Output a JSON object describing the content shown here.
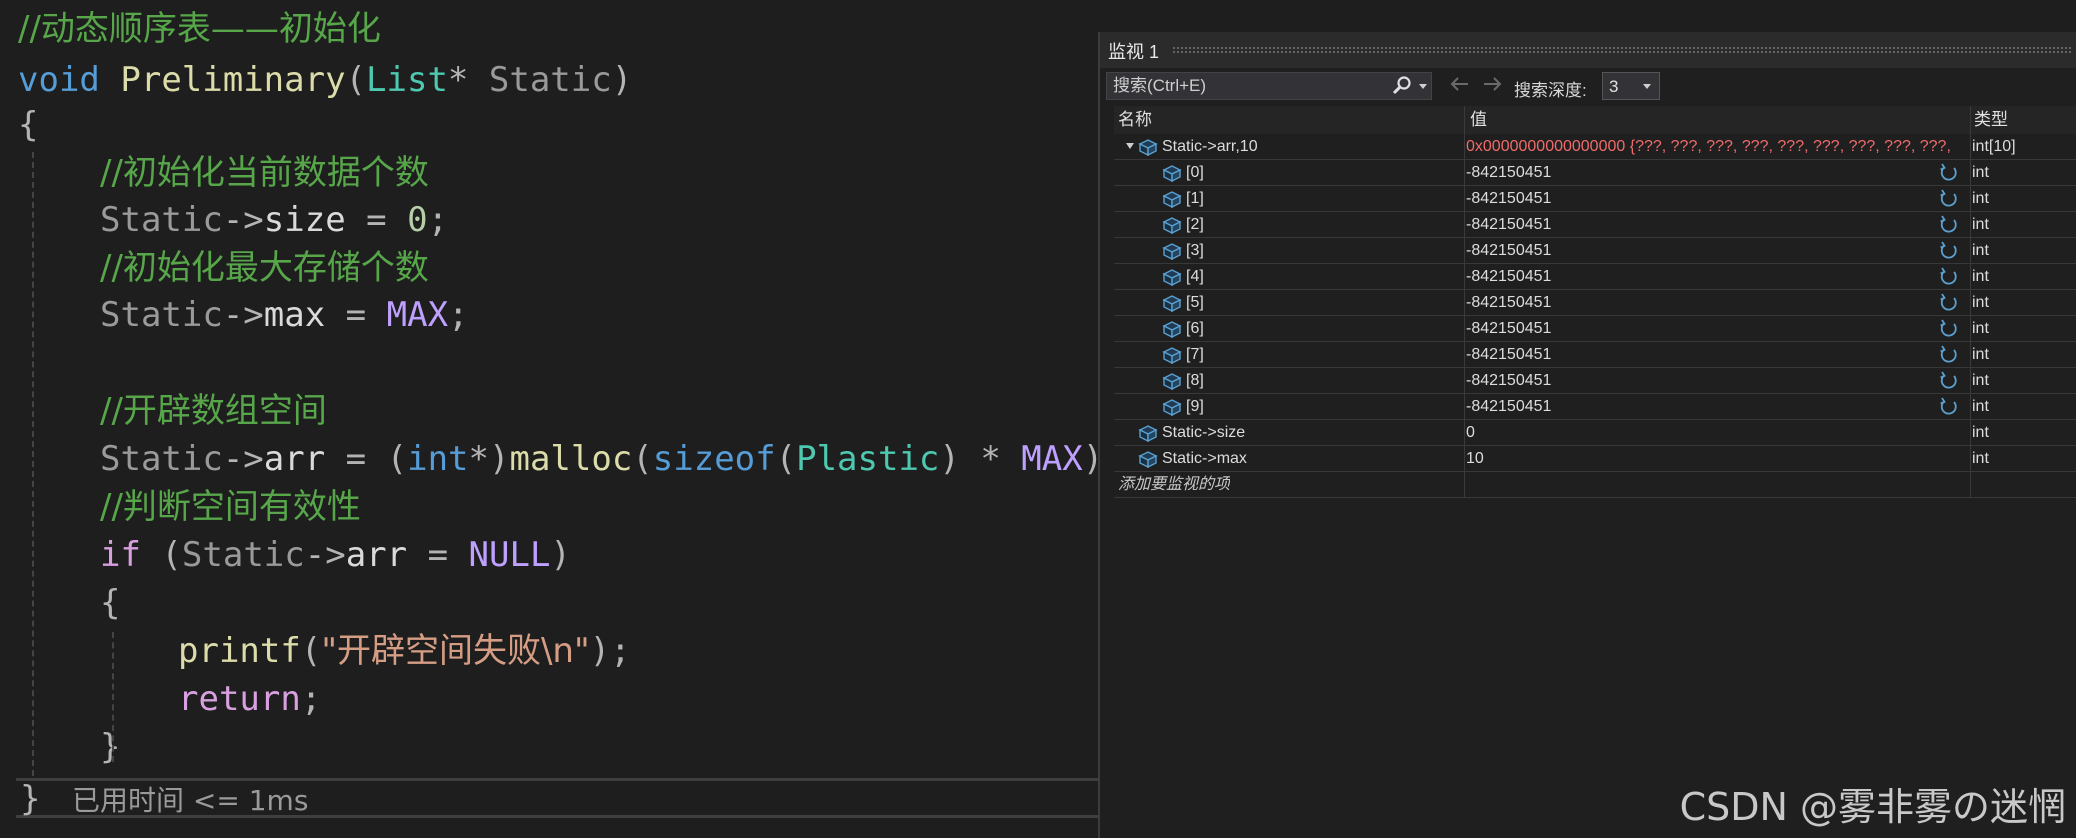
{
  "editor": {
    "lines": [
      {
        "parts": [
          {
            "cls": "c-comment",
            "t": "//动态顺序表——初始化"
          }
        ]
      },
      {
        "parts": [
          {
            "cls": "c-kw",
            "t": "void"
          },
          {
            "cls": "",
            "t": " "
          },
          {
            "cls": "c-fn",
            "t": "Preliminary"
          },
          {
            "cls": "c-punct",
            "t": "("
          },
          {
            "cls": "c-type",
            "t": "List"
          },
          {
            "cls": "c-punct",
            "t": "* "
          },
          {
            "cls": "c-param",
            "t": "Static"
          },
          {
            "cls": "c-punct",
            "t": ")"
          }
        ]
      },
      {
        "parts": [
          {
            "cls": "c-punct",
            "t": "{"
          }
        ]
      },
      {
        "parts": [
          {
            "cls": "c-comment",
            "t": "//初始化当前数据个数"
          }
        ]
      },
      {
        "parts": [
          {
            "cls": "c-param",
            "t": "Static"
          },
          {
            "cls": "c-punct",
            "t": "->"
          },
          {
            "cls": "c-member",
            "t": "size"
          },
          {
            "cls": "c-punct",
            "t": " = "
          },
          {
            "cls": "c-num",
            "t": "0"
          },
          {
            "cls": "c-punct",
            "t": ";"
          }
        ]
      },
      {
        "parts": [
          {
            "cls": "c-comment",
            "t": "//初始化最大存储个数"
          }
        ]
      },
      {
        "parts": [
          {
            "cls": "c-param",
            "t": "Static"
          },
          {
            "cls": "c-punct",
            "t": "->"
          },
          {
            "cls": "c-member",
            "t": "max"
          },
          {
            "cls": "c-punct",
            "t": " = "
          },
          {
            "cls": "c-macro",
            "t": "MAX"
          },
          {
            "cls": "c-punct",
            "t": ";"
          }
        ]
      },
      {
        "parts": []
      },
      {
        "parts": [
          {
            "cls": "c-comment",
            "t": "//开辟数组空间"
          }
        ]
      },
      {
        "parts": [
          {
            "cls": "c-param",
            "t": "Static"
          },
          {
            "cls": "c-punct",
            "t": "->"
          },
          {
            "cls": "c-member",
            "t": "arr"
          },
          {
            "cls": "c-punct",
            "t": " = ("
          },
          {
            "cls": "c-kw",
            "t": "int"
          },
          {
            "cls": "c-punct",
            "t": "*)"
          },
          {
            "cls": "c-fn",
            "t": "malloc"
          },
          {
            "cls": "c-punct",
            "t": "("
          },
          {
            "cls": "c-kw",
            "t": "sizeof"
          },
          {
            "cls": "c-punct",
            "t": "("
          },
          {
            "cls": "c-type",
            "t": "Plastic"
          },
          {
            "cls": "c-punct",
            "t": ") * "
          },
          {
            "cls": "c-macro",
            "t": "MAX"
          },
          {
            "cls": "c-punct",
            "t": ");"
          }
        ]
      },
      {
        "parts": [
          {
            "cls": "c-comment",
            "t": "//判断空间有效性"
          }
        ]
      },
      {
        "parts": [
          {
            "cls": "c-ctrl",
            "t": "if"
          },
          {
            "cls": "c-punct",
            "t": " ("
          },
          {
            "cls": "c-param",
            "t": "Static"
          },
          {
            "cls": "c-punct",
            "t": "->"
          },
          {
            "cls": "c-member",
            "t": "arr"
          },
          {
            "cls": "c-punct",
            "t": " = "
          },
          {
            "cls": "c-macro",
            "t": "NULL"
          },
          {
            "cls": "c-punct",
            "t": ")"
          }
        ]
      },
      {
        "parts": [
          {
            "cls": "c-punct",
            "t": "{"
          }
        ]
      },
      {
        "parts": [
          {
            "cls": "c-fn",
            "t": "printf"
          },
          {
            "cls": "c-punct",
            "t": "("
          },
          {
            "cls": "c-str",
            "t": "\"开辟空间失败\\n\""
          },
          {
            "cls": "c-punct",
            "t": ");"
          }
        ]
      },
      {
        "parts": [
          {
            "cls": "c-ctrl",
            "t": "return"
          },
          {
            "cls": "c-punct",
            "t": ";"
          }
        ]
      },
      {
        "parts": [
          {
            "cls": "c-punct",
            "t": "}"
          }
        ]
      }
    ],
    "closing_brace": "}",
    "elapsed_text": "已用时间 <= 1ms"
  },
  "watch": {
    "title": "监视 1",
    "search_placeholder": "搜索(Ctrl+E)",
    "depth_label": "搜索深度:",
    "depth_value": "3",
    "headers": {
      "name": "名称",
      "value": "值",
      "type": "类型"
    },
    "rows": [
      {
        "name": "Static->arr,10",
        "value": "0x0000000000000000 {???, ???, ???, ???, ???, ???, ???, ???, ???, ?...",
        "type": "int[10]",
        "level": 0,
        "expanded": true,
        "changed": true,
        "refresh": false
      },
      {
        "name": "[0]",
        "value": "-842150451",
        "type": "int",
        "level": 1,
        "changed": false,
        "refresh": true
      },
      {
        "name": "[1]",
        "value": "-842150451",
        "type": "int",
        "level": 1,
        "changed": false,
        "refresh": true
      },
      {
        "name": "[2]",
        "value": "-842150451",
        "type": "int",
        "level": 1,
        "changed": false,
        "refresh": true
      },
      {
        "name": "[3]",
        "value": "-842150451",
        "type": "int",
        "level": 1,
        "changed": false,
        "refresh": true
      },
      {
        "name": "[4]",
        "value": "-842150451",
        "type": "int",
        "level": 1,
        "changed": false,
        "refresh": true
      },
      {
        "name": "[5]",
        "value": "-842150451",
        "type": "int",
        "level": 1,
        "changed": false,
        "refresh": true
      },
      {
        "name": "[6]",
        "value": "-842150451",
        "type": "int",
        "level": 1,
        "changed": false,
        "refresh": true
      },
      {
        "name": "[7]",
        "value": "-842150451",
        "type": "int",
        "level": 1,
        "changed": false,
        "refresh": true
      },
      {
        "name": "[8]",
        "value": "-842150451",
        "type": "int",
        "level": 1,
        "changed": false,
        "refresh": true
      },
      {
        "name": "[9]",
        "value": "-842150451",
        "type": "int",
        "level": 1,
        "changed": false,
        "refresh": true
      },
      {
        "name": "Static->size",
        "value": "0",
        "type": "int",
        "level": 0,
        "changed": false,
        "refresh": false
      },
      {
        "name": "Static->max",
        "value": "10",
        "type": "int",
        "level": 0,
        "changed": false,
        "refresh": false
      }
    ],
    "add_item_text": "添加要监视的项"
  },
  "watermark": "CSDN @雾非雾の迷惘",
  "colors": {
    "changed_value": "#f16b6b",
    "icon_blue": "#5ba0d0"
  }
}
